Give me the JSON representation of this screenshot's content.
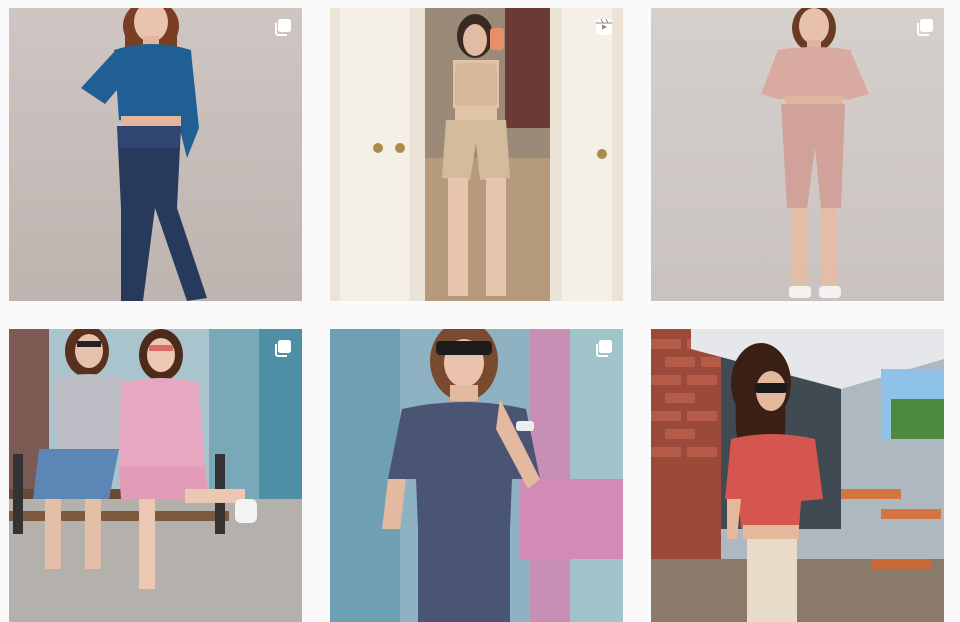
{
  "grid": {
    "posts": [
      {
        "badge": "carousel-icon",
        "subject": "blue-sweater-jeans"
      },
      {
        "badge": "reels-icon",
        "subject": "beige-mirror-selfie"
      },
      {
        "badge": "carousel-icon",
        "subject": "pink-set-shorts"
      },
      {
        "badge": "carousel-icon",
        "subject": "two-women-bench"
      },
      {
        "badge": "carousel-icon",
        "subject": "grey-tee-sunglasses"
      },
      {
        "badge": "",
        "subject": "coral-tee-cafe"
      }
    ]
  },
  "colors": {
    "page_bg": "#fafafa",
    "badge": "#ffffff"
  }
}
